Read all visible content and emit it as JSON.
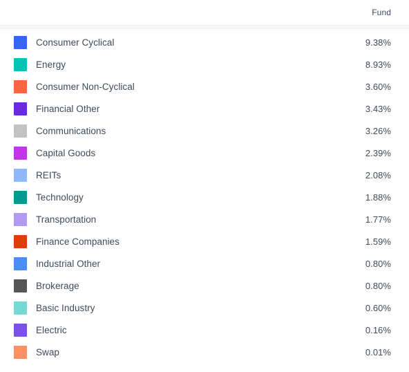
{
  "header": {
    "value_column_label": "Fund"
  },
  "chart_data": {
    "type": "table",
    "title": "",
    "xlabel": "",
    "ylabel": "",
    "legend_position": "left",
    "categories": [
      "Consumer Cyclical",
      "Energy",
      "Consumer Non-Cyclical",
      "Financial Other",
      "Communications",
      "Capital Goods",
      "REITs",
      "Technology",
      "Transportation",
      "Finance Companies",
      "Industrial Other",
      "Brokerage",
      "Basic Industry",
      "Electric",
      "Swap"
    ],
    "values": [
      9.38,
      8.93,
      3.6,
      3.43,
      3.26,
      2.39,
      2.08,
      1.88,
      1.77,
      1.59,
      0.8,
      0.8,
      0.6,
      0.16,
      0.01
    ],
    "value_labels": [
      "9.38%",
      "8.93%",
      "3.60%",
      "3.43%",
      "3.26%",
      "2.39%",
      "2.08%",
      "1.88%",
      "1.77%",
      "1.59%",
      "0.80%",
      "0.80%",
      "0.60%",
      "0.16%",
      "0.01%"
    ],
    "colors": [
      "#3366f5",
      "#00c4b4",
      "#fa6640",
      "#6a2be0",
      "#c2c2c2",
      "#c235e8",
      "#8fb8fb",
      "#009b8e",
      "#b29af0",
      "#e03c06",
      "#4a8ef5",
      "#565656",
      "#74d9d2",
      "#7b52e8",
      "#fa9263"
    ],
    "series": [
      {
        "name": "Fund",
        "values": [
          9.38,
          8.93,
          3.6,
          3.43,
          3.26,
          2.39,
          2.08,
          1.88,
          1.77,
          1.59,
          0.8,
          0.8,
          0.6,
          0.16,
          0.01
        ]
      }
    ]
  },
  "rows": [
    {
      "label": "Consumer Cyclical",
      "value": "9.38%",
      "color": "#3366f5"
    },
    {
      "label": "Energy",
      "value": "8.93%",
      "color": "#00c4b4"
    },
    {
      "label": "Consumer Non-Cyclical",
      "value": "3.60%",
      "color": "#fa6640"
    },
    {
      "label": "Financial Other",
      "value": "3.43%",
      "color": "#6a2be0"
    },
    {
      "label": "Communications",
      "value": "3.26%",
      "color": "#c2c2c2"
    },
    {
      "label": "Capital Goods",
      "value": "2.39%",
      "color": "#c235e8"
    },
    {
      "label": "REITs",
      "value": "2.08%",
      "color": "#8fb8fb"
    },
    {
      "label": "Technology",
      "value": "1.88%",
      "color": "#009b8e"
    },
    {
      "label": "Transportation",
      "value": "1.77%",
      "color": "#b29af0"
    },
    {
      "label": "Finance Companies",
      "value": "1.59%",
      "color": "#e03c06"
    },
    {
      "label": "Industrial Other",
      "value": "0.80%",
      "color": "#4a8ef5"
    },
    {
      "label": "Brokerage",
      "value": "0.80%",
      "color": "#565656"
    },
    {
      "label": "Basic Industry",
      "value": "0.60%",
      "color": "#74d9d2"
    },
    {
      "label": "Electric",
      "value": "0.16%",
      "color": "#7b52e8"
    },
    {
      "label": "Swap",
      "value": "0.01%",
      "color": "#fa9263"
    }
  ]
}
